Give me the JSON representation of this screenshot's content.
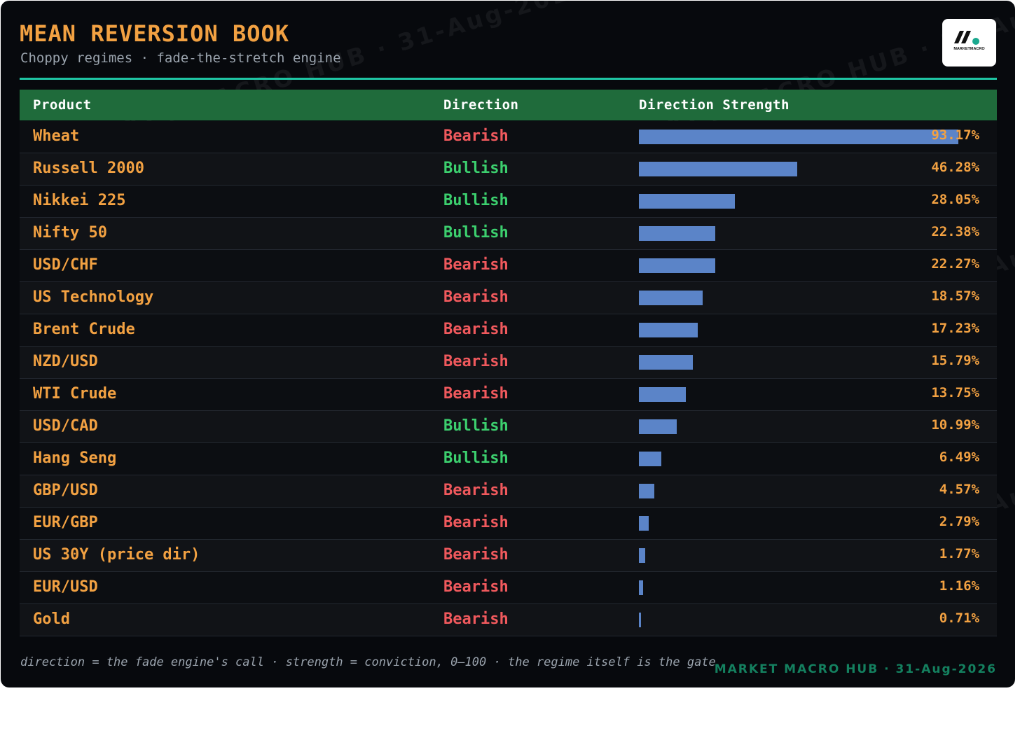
{
  "header": {
    "title": "MEAN REVERSION BOOK",
    "subtitle": "Choppy regimes · fade-the-stretch engine",
    "logo_name": "MarketMacro logo",
    "logo_text": "MARKETMACRO"
  },
  "table": {
    "columns": [
      "Product",
      "Direction",
      "Direction Strength"
    ],
    "rows": [
      {
        "product": "Wheat",
        "direction": "Bearish",
        "strength": 93.17,
        "strength_label": "93.17%"
      },
      {
        "product": "Russell 2000",
        "direction": "Bullish",
        "strength": 46.28,
        "strength_label": "46.28%"
      },
      {
        "product": "Nikkei 225",
        "direction": "Bullish",
        "strength": 28.05,
        "strength_label": "28.05%"
      },
      {
        "product": "Nifty 50",
        "direction": "Bullish",
        "strength": 22.38,
        "strength_label": "22.38%"
      },
      {
        "product": "USD/CHF",
        "direction": "Bearish",
        "strength": 22.27,
        "strength_label": "22.27%"
      },
      {
        "product": "US Technology",
        "direction": "Bearish",
        "strength": 18.57,
        "strength_label": "18.57%"
      },
      {
        "product": "Brent Crude",
        "direction": "Bearish",
        "strength": 17.23,
        "strength_label": "17.23%"
      },
      {
        "product": "NZD/USD",
        "direction": "Bearish",
        "strength": 15.79,
        "strength_label": "15.79%"
      },
      {
        "product": "WTI Crude",
        "direction": "Bearish",
        "strength": 13.75,
        "strength_label": "13.75%"
      },
      {
        "product": "USD/CAD",
        "direction": "Bullish",
        "strength": 10.99,
        "strength_label": "10.99%"
      },
      {
        "product": "Hang Seng",
        "direction": "Bullish",
        "strength": 6.49,
        "strength_label": "6.49%"
      },
      {
        "product": "GBP/USD",
        "direction": "Bearish",
        "strength": 4.57,
        "strength_label": "4.57%"
      },
      {
        "product": "EUR/GBP",
        "direction": "Bearish",
        "strength": 2.79,
        "strength_label": "2.79%"
      },
      {
        "product": "US 30Y (price dir)",
        "direction": "Bearish",
        "strength": 1.77,
        "strength_label": "1.77%"
      },
      {
        "product": "EUR/USD",
        "direction": "Bearish",
        "strength": 1.16,
        "strength_label": "1.16%"
      },
      {
        "product": "Gold",
        "direction": "Bearish",
        "strength": 0.71,
        "strength_label": "0.71%"
      }
    ]
  },
  "watermark_text": "MARKET MACRO HUB · 31-Aug-2026",
  "footer": {
    "note": "direction = the fade engine's call · strength = conviction, 0–100 · the regime itself is the gate",
    "brand": "MARKET MACRO HUB · 31-Aug-2026"
  },
  "colors": {
    "bullish": "#3ccf6e",
    "bearish": "#f0595d",
    "accent": "#f2a142",
    "bar": "#5b84c8",
    "header_bg": "#1f6b3b",
    "rule": "#1fc6a4"
  }
}
